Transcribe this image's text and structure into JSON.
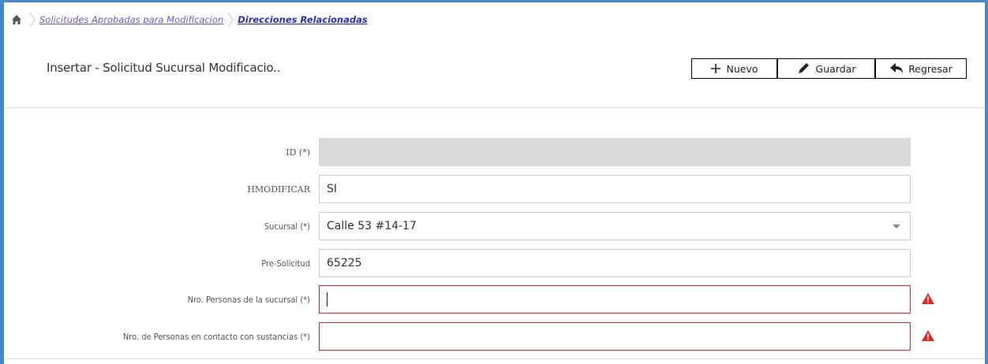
{
  "breadcrumb": {
    "items": [
      "Solicitudes Aprobadas para Modificacion",
      "Direcciones Relacionadas"
    ]
  },
  "page": {
    "title": "Insertar - Solicitud Sucursal Modificacio.."
  },
  "toolbar": {
    "nuevo": "Nuevo",
    "guardar": "Guardar",
    "regresar": "Regresar"
  },
  "form": {
    "id": {
      "label": "ID (*)",
      "value": ""
    },
    "hmodificar": {
      "label": "HMODIFICAR",
      "value": "SI"
    },
    "sucursal": {
      "label": "Sucursal (*)",
      "value": "Calle 53 #14-17"
    },
    "presolicitud": {
      "label": "Pre-Solicitud",
      "value": "65225"
    },
    "nro_personas": {
      "label": "Nro. Personas de la sucursal (*)",
      "value": ""
    },
    "nro_contacto": {
      "label": "Nro. de Personas en contacto con sustancias (*)",
      "value": ""
    }
  },
  "colors": {
    "frame": "#4a86c8",
    "error": "#e32626",
    "link": "#6a5acd",
    "link_active": "#2430c0"
  },
  "icons": [
    "home-icon",
    "plus-icon",
    "pencil-icon",
    "reply-icon",
    "warning-icon",
    "chevron-down-icon"
  ]
}
